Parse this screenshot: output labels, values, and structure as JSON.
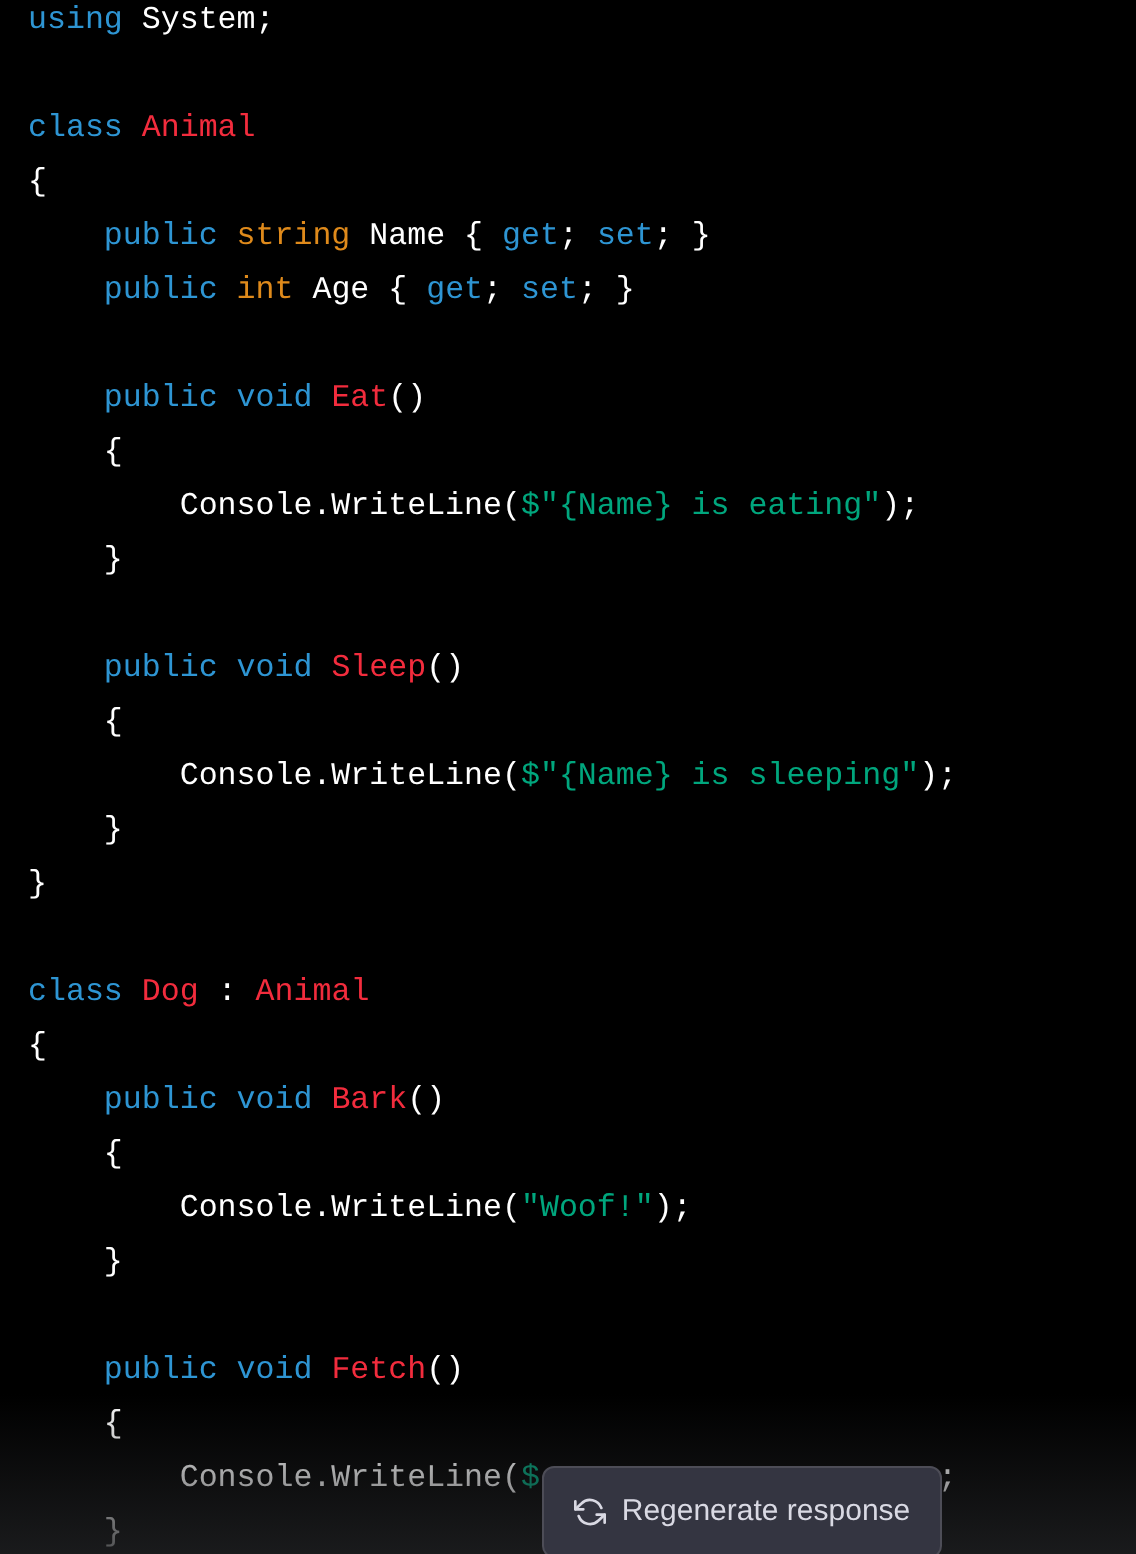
{
  "code_blocks": [
    {
      "lines": [
        {
          "tokens": [
            {
              "kind": "kw",
              "text": "using"
            },
            {
              "kind": "plain",
              "text": " System;"
            }
          ]
        }
      ]
    },
    {
      "lines": [
        {
          "tokens": [
            {
              "kind": "kw",
              "text": "class "
            },
            {
              "kind": "name",
              "text": "Animal"
            }
          ]
        },
        {
          "tokens": [
            {
              "kind": "plain",
              "text": "{"
            }
          ]
        },
        {
          "tokens": [
            {
              "kind": "kw",
              "text": "    public "
            },
            {
              "kind": "type",
              "text": "string"
            },
            {
              "kind": "plain",
              "text": " Name { "
            },
            {
              "kind": "kw",
              "text": "get"
            },
            {
              "kind": "plain",
              "text": "; "
            },
            {
              "kind": "kw",
              "text": "set"
            },
            {
              "kind": "plain",
              "text": "; }"
            }
          ]
        },
        {
          "tokens": [
            {
              "kind": "kw",
              "text": "    public "
            },
            {
              "kind": "type",
              "text": "int"
            },
            {
              "kind": "plain",
              "text": " Age { "
            },
            {
              "kind": "kw",
              "text": "get"
            },
            {
              "kind": "plain",
              "text": "; "
            },
            {
              "kind": "kw",
              "text": "set"
            },
            {
              "kind": "plain",
              "text": "; }"
            }
          ]
        }
      ]
    },
    {
      "lines": [
        {
          "tokens": [
            {
              "kind": "kw",
              "text": "    public void "
            },
            {
              "kind": "name",
              "text": "Eat"
            },
            {
              "kind": "plain",
              "text": "()"
            }
          ]
        },
        {
          "tokens": [
            {
              "kind": "plain",
              "text": "    {"
            }
          ]
        },
        {
          "tokens": [
            {
              "kind": "plain",
              "text": "        Console.WriteLine("
            },
            {
              "kind": "str",
              "text": "$\"{Name} is eating\""
            },
            {
              "kind": "plain",
              "text": ");"
            }
          ]
        },
        {
          "tokens": [
            {
              "kind": "plain",
              "text": "    }"
            }
          ]
        }
      ]
    },
    {
      "lines": [
        {
          "tokens": [
            {
              "kind": "kw",
              "text": "    public void "
            },
            {
              "kind": "name",
              "text": "Sleep"
            },
            {
              "kind": "plain",
              "text": "()"
            }
          ]
        },
        {
          "tokens": [
            {
              "kind": "plain",
              "text": "    {"
            }
          ]
        },
        {
          "tokens": [
            {
              "kind": "plain",
              "text": "        Console.WriteLine("
            },
            {
              "kind": "str",
              "text": "$\"{Name} is sleeping\""
            },
            {
              "kind": "plain",
              "text": ");"
            }
          ]
        },
        {
          "tokens": [
            {
              "kind": "plain",
              "text": "    }"
            }
          ]
        },
        {
          "tokens": [
            {
              "kind": "plain",
              "text": "}"
            }
          ]
        }
      ]
    },
    {
      "lines": [
        {
          "tokens": [
            {
              "kind": "kw",
              "text": "class "
            },
            {
              "kind": "name",
              "text": "Dog"
            },
            {
              "kind": "plain",
              "text": " : "
            },
            {
              "kind": "name",
              "text": "Animal"
            }
          ]
        },
        {
          "tokens": [
            {
              "kind": "plain",
              "text": "{"
            }
          ]
        },
        {
          "tokens": [
            {
              "kind": "kw",
              "text": "    public void "
            },
            {
              "kind": "name",
              "text": "Bark"
            },
            {
              "kind": "plain",
              "text": "()"
            }
          ]
        },
        {
          "tokens": [
            {
              "kind": "plain",
              "text": "    {"
            }
          ]
        },
        {
          "tokens": [
            {
              "kind": "plain",
              "text": "        Console.WriteLine("
            },
            {
              "kind": "str",
              "text": "\"Woof!\""
            },
            {
              "kind": "plain",
              "text": ");"
            }
          ]
        },
        {
          "tokens": [
            {
              "kind": "plain",
              "text": "    }"
            }
          ]
        }
      ]
    },
    {
      "lines": [
        {
          "tokens": [
            {
              "kind": "kw",
              "text": "    public void "
            },
            {
              "kind": "name",
              "text": "Fetch"
            },
            {
              "kind": "plain",
              "text": "()"
            }
          ]
        },
        {
          "tokens": [
            {
              "kind": "plain",
              "text": "    {"
            }
          ]
        },
        {
          "tokens": [
            {
              "kind": "plain",
              "text": "        Console.WriteLine("
            },
            {
              "kind": "str",
              "text": "$"
            },
            {
              "kind": "gap"
            },
            {
              "kind": "plain",
              "text": ";"
            }
          ]
        },
        {
          "tokens": [
            {
              "kind": "plain",
              "text": "    }"
            }
          ]
        }
      ]
    }
  ],
  "regenerate_button": {
    "label": "Regenerate response"
  }
}
